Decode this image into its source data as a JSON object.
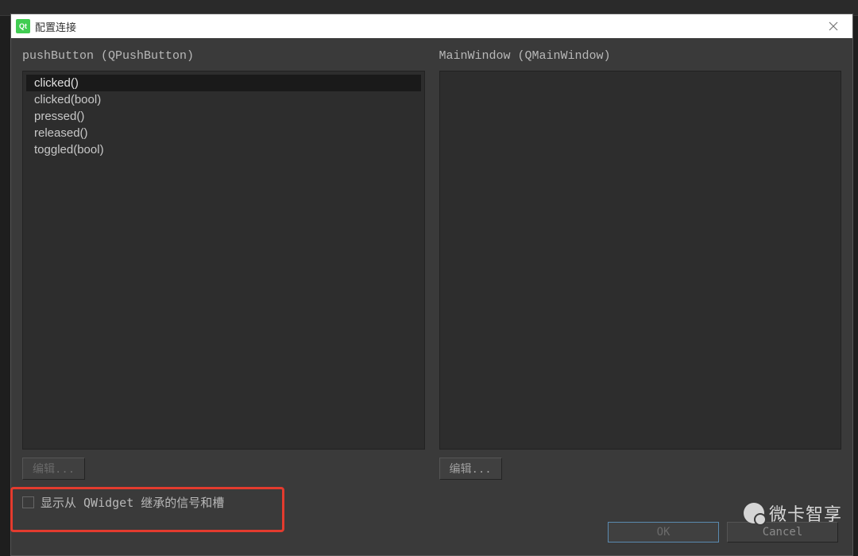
{
  "titlebar": {
    "qt_icon_label": "Qt",
    "title": "配置连接"
  },
  "left_panel": {
    "header": "pushButton (QPushButton)",
    "signals": [
      "clicked()",
      "clicked(bool)",
      "pressed()",
      "released()",
      "toggled(bool)"
    ],
    "selected_index": 0,
    "edit_label": "编辑..."
  },
  "right_panel": {
    "header": "MainWindow (QMainWindow)",
    "slots": [],
    "edit_label": "编辑..."
  },
  "checkbox": {
    "label": "显示从 QWidget 继承的信号和槽",
    "checked": false
  },
  "buttons": {
    "ok": "OK",
    "cancel": "Cancel"
  },
  "watermark": {
    "text": "微卡智享"
  }
}
